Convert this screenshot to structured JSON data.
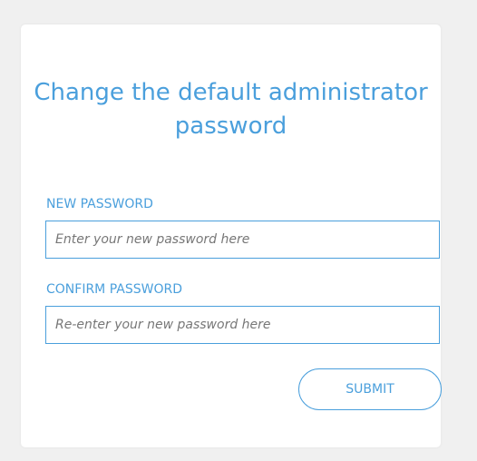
{
  "form": {
    "title": "Change the default administrator password",
    "new_password": {
      "label": "NEW PASSWORD",
      "placeholder": "Enter your new password here",
      "value": ""
    },
    "confirm_password": {
      "label": "CONFIRM PASSWORD",
      "placeholder": "Re-enter your new password here",
      "value": ""
    },
    "submit_label": "SUBMIT"
  },
  "colors": {
    "accent": "#4a9fdc",
    "background": "#f0f0f0",
    "card": "#ffffff"
  }
}
